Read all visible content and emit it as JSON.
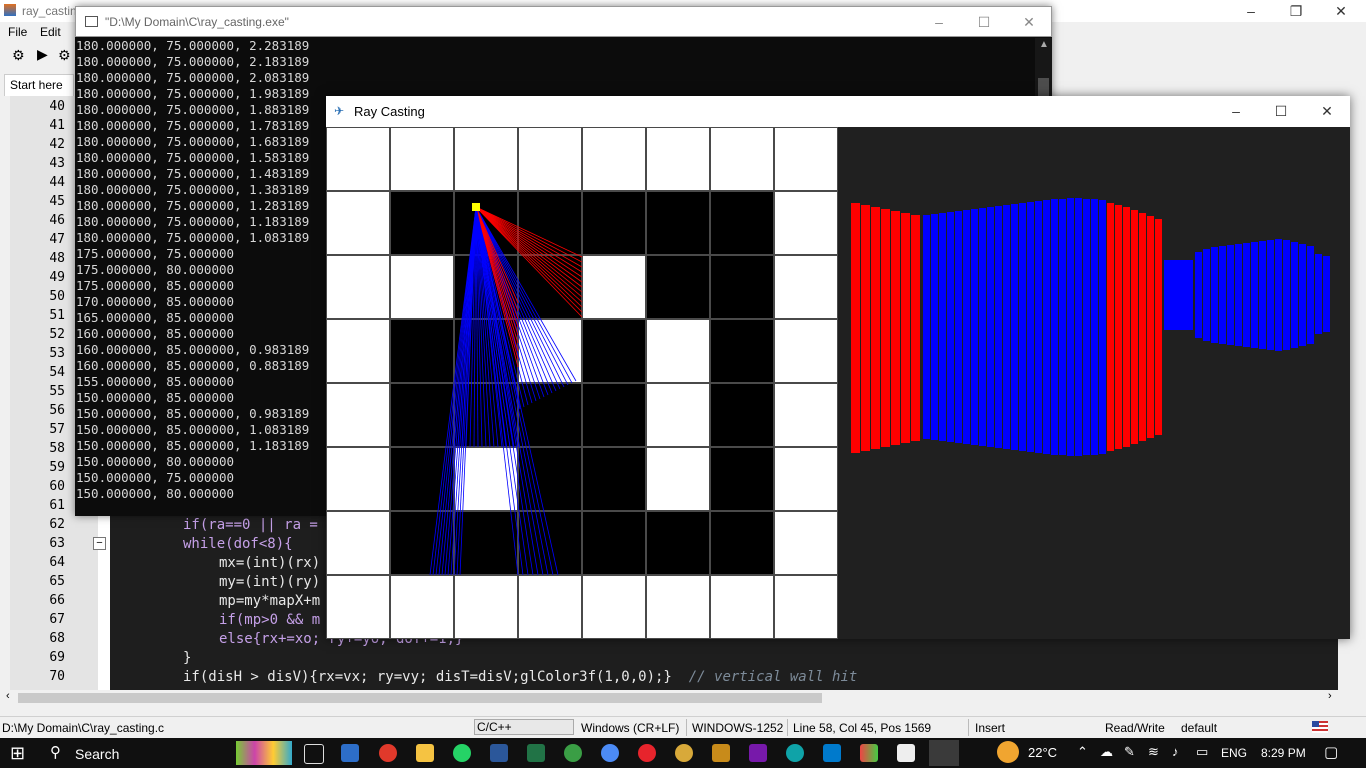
{
  "ide": {
    "title": "ray_castin",
    "menu": [
      "File",
      "Edit"
    ],
    "tab": "Start here",
    "line_numbers": [
      "40",
      "41",
      "42",
      "43",
      "44",
      "45",
      "46",
      "47",
      "48",
      "49",
      "50",
      "51",
      "52",
      "53",
      "54",
      "55",
      "56",
      "57",
      "58",
      "59",
      "60",
      "61",
      "62",
      "63",
      "64",
      "65",
      "66",
      "67",
      "68",
      "69",
      "70"
    ],
    "code": {
      "l62": "if(ra==0 || ra =",
      "l63": "while(dof<8){",
      "l64": "mx=(int)(rx)",
      "l65": "my=(int)(ry)",
      "l66": "mp=my*mapX+m",
      "l67": "if(mp>0 && m",
      "l68": "else{rx+=xo; ry+=yo; dof+=1;}",
      "l69": "}",
      "l70": "if(disH > disV){rx=vx; ry=vy; disT=disV;glColor3f(1,0,0);}",
      "l70_comment": "// vertical wall hit"
    },
    "status": {
      "path": "D:\\My Domain\\C\\ray_casting.c",
      "language": "C/C++",
      "eol": "Windows (CR+LF)",
      "encoding": "WINDOWS-1252",
      "position": "Line 58, Col 45, Pos 1569",
      "mode": "Insert",
      "access": "Read/Write",
      "profile": "default"
    }
  },
  "console": {
    "title": "\"D:\\My Domain\\C\\ray_casting.exe\"",
    "lines": [
      "180.000000, 75.000000, 2.283189",
      "180.000000, 75.000000, 2.183189",
      "180.000000, 75.000000, 2.083189",
      "180.000000, 75.000000, 1.983189",
      "180.000000, 75.000000, 1.883189",
      "180.000000, 75.000000, 1.783189",
      "180.000000, 75.000000, 1.683189",
      "180.000000, 75.000000, 1.583189",
      "180.000000, 75.000000, 1.483189",
      "180.000000, 75.000000, 1.383189",
      "180.000000, 75.000000, 1.283189",
      "180.000000, 75.000000, 1.183189",
      "180.000000, 75.000000, 1.083189",
      "175.000000, 75.000000",
      "175.000000, 80.000000",
      "175.000000, 85.000000",
      "170.000000, 85.000000",
      "165.000000, 85.000000",
      "160.000000, 85.000000",
      "160.000000, 85.000000, 0.983189",
      "160.000000, 85.000000, 0.883189",
      "155.000000, 85.000000",
      "150.000000, 85.000000",
      "150.000000, 85.000000, 0.983189",
      "150.000000, 85.000000, 1.083189",
      "150.000000, 85.000000, 1.183189",
      "150.000000, 80.000000",
      "150.000000, 75.000000",
      "150.000000, 80.000000"
    ]
  },
  "raycast_window": {
    "title": "Ray Casting",
    "map": [
      [
        1,
        1,
        1,
        1,
        1,
        1,
        1,
        1
      ],
      [
        1,
        0,
        0,
        0,
        0,
        0,
        0,
        1
      ],
      [
        1,
        1,
        0,
        0,
        1,
        0,
        0,
        1
      ],
      [
        1,
        0,
        0,
        1,
        0,
        1,
        0,
        1
      ],
      [
        1,
        0,
        0,
        0,
        0,
        1,
        0,
        1
      ],
      [
        1,
        0,
        1,
        0,
        0,
        1,
        0,
        1
      ],
      [
        1,
        0,
        0,
        0,
        0,
        0,
        0,
        1
      ],
      [
        1,
        1,
        1,
        1,
        1,
        1,
        1,
        1
      ]
    ],
    "colors": {
      "wall": "#ffffff",
      "floor": "#000000",
      "player": "#ffff00",
      "ray_h": "#0000ff",
      "ray_v": "#ff0000",
      "bg": "#202020"
    }
  },
  "taskbar": {
    "search": "Search",
    "weather": "22°C",
    "language": "ENG",
    "time": "8:29 PM"
  }
}
